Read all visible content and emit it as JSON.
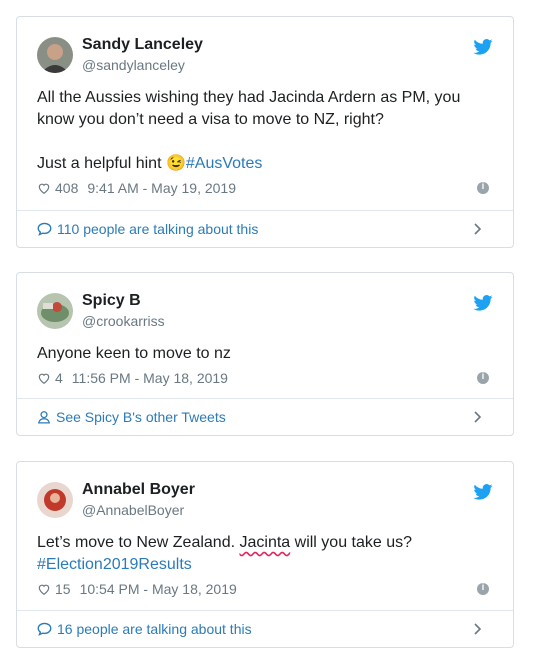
{
  "tweets": [
    {
      "name": "Sandy Lanceley",
      "handle": "@sandylanceley",
      "text_line1": "All the Aussies wishing they had Jacinda Ardern as PM, you know you don’t need a visa to move to NZ, right?",
      "text_line2_prefix": "Just a helpful hint ",
      "emoji": "😉",
      "hashtag": "#AusVotes",
      "likes": "408",
      "timestamp": "9:41 AM - May 19, 2019",
      "footer": "110 people are talking about this",
      "footer_icon": "comment-icon"
    },
    {
      "name": "Spicy B",
      "handle": "@crookarriss",
      "text_line1": "Anyone keen to move to nz",
      "likes": "4",
      "timestamp": "11:56 PM - May 18, 2019",
      "footer": "See Spicy B's other Tweets",
      "footer_icon": "person-icon"
    },
    {
      "name": "Annabel Boyer",
      "handle": "@AnnabelBoyer",
      "text_part1": "Let’s move to New Zealand. ",
      "text_underlined": "Jacinta",
      "text_part2": " will you take us?",
      "hashtag": "#Election2019Results",
      "likes": "15",
      "timestamp": "10:54 PM - May 18, 2019",
      "footer": "16 people are talking about this",
      "footer_icon": "comment-icon"
    }
  ],
  "colors": {
    "link": "#2b7bb9",
    "twitter_blue": "#1da1f2",
    "meta": "#697882"
  }
}
